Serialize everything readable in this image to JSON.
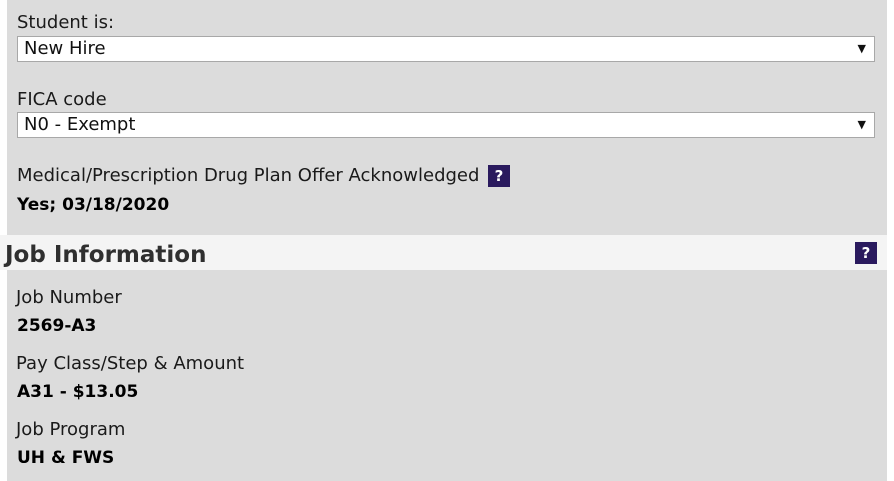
{
  "student_status": {
    "label": "Student is:",
    "selected": "New Hire"
  },
  "fica": {
    "label": "FICA code",
    "selected": "N0 - Exempt"
  },
  "medical": {
    "label": "Medical/Prescription Drug Plan Offer Acknowledged",
    "help": "?",
    "value": "Yes; 03/18/2020"
  },
  "job_information": {
    "title": "Job Information",
    "help": "?",
    "fields": [
      {
        "label": "Job Number",
        "value": "2569-A3"
      },
      {
        "label": "Pay Class/Step & Amount",
        "value": "A31 - $13.05"
      },
      {
        "label": "Job Program",
        "value": "UH & FWS"
      }
    ]
  },
  "colors": {
    "panel_bg": "#dcdcdc",
    "header_bg": "#f4f4f4",
    "help_icon_bg": "#2a1a5e"
  },
  "icons": {
    "dropdown": "chevron-down-icon",
    "help": "help-icon"
  }
}
